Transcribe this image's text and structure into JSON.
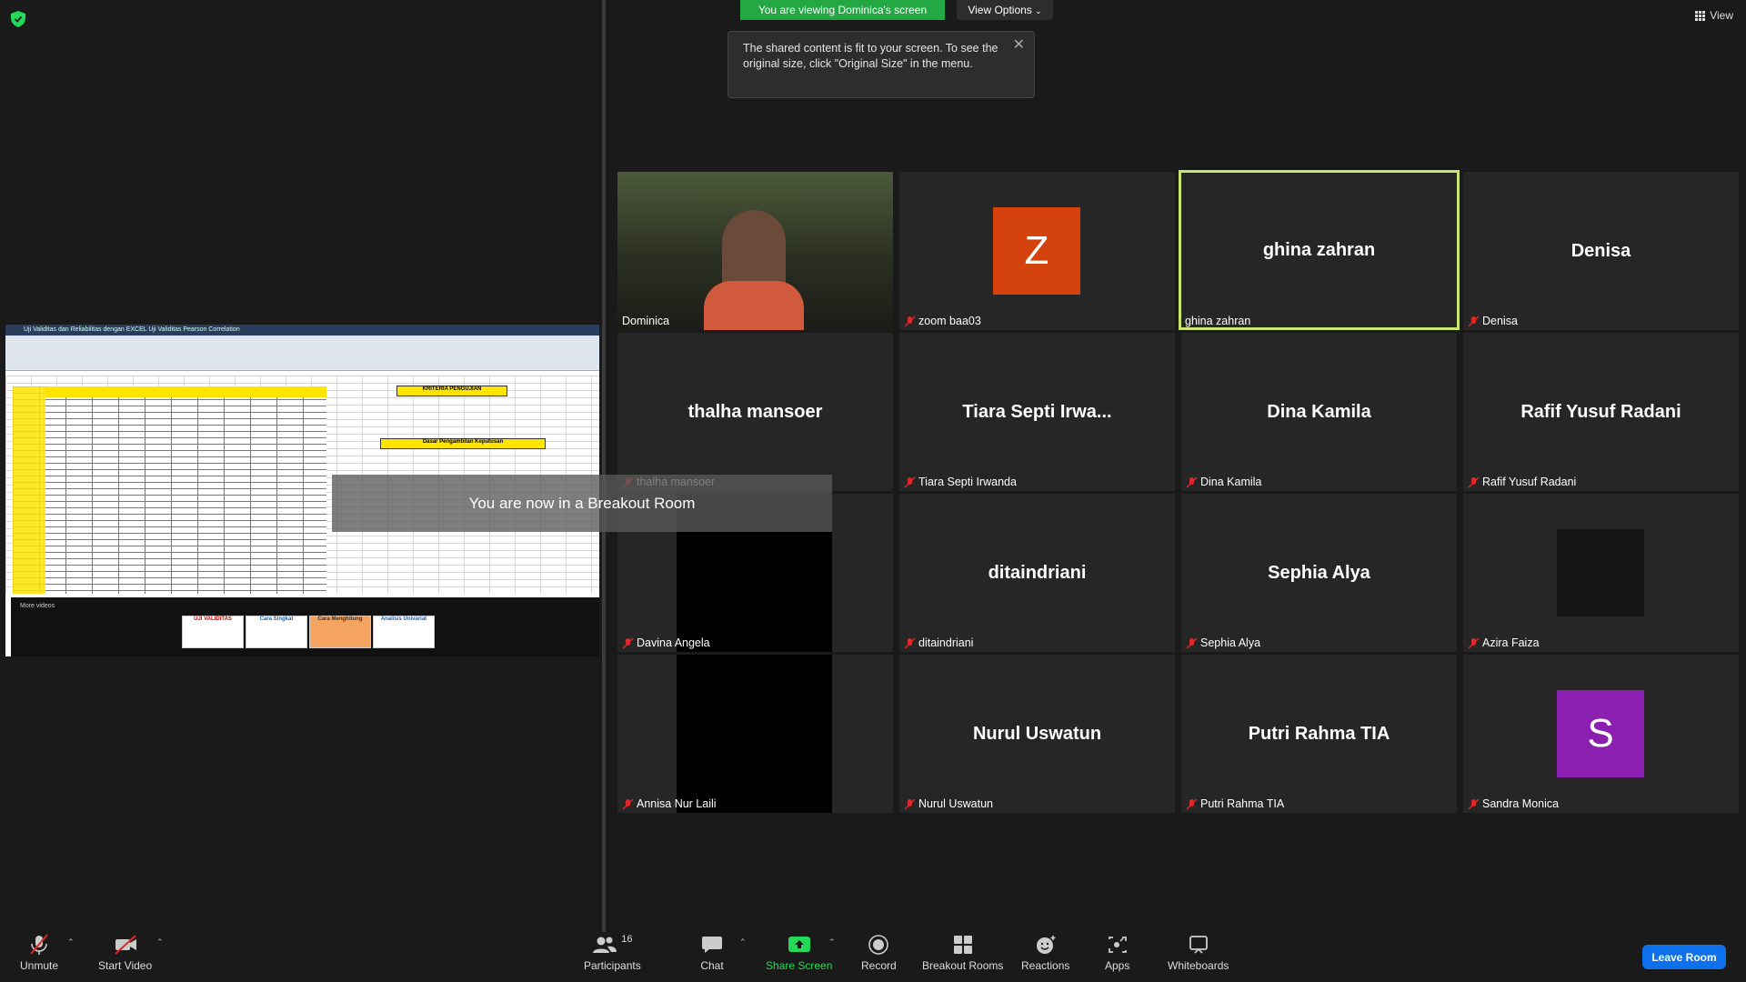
{
  "banner": {
    "viewing_text": "You are viewing Dominica's screen",
    "view_options_label": "View Options"
  },
  "tooltip": {
    "text": "The shared content is fit to your screen. To see the original size, click \"Original Size\" in the menu."
  },
  "view_button": {
    "label": "View"
  },
  "breakout_toast": {
    "text": "You are now in a Breakout Room"
  },
  "participants": [
    {
      "name": "Dominica",
      "display": "video",
      "muted": false
    },
    {
      "name": "zoom baa03",
      "display": "avatar",
      "avatar_letter": "Z",
      "avatar_color": "#d4430e",
      "muted": true
    },
    {
      "name": "ghina zahran",
      "display": "name",
      "muted": false,
      "active_speaker": true
    },
    {
      "name": "Denisa",
      "display": "name",
      "muted": true
    },
    {
      "name": "thalha mansoer",
      "display": "name",
      "muted": true
    },
    {
      "name": "Tiara Septi Irwa...",
      "label": "Tiara Septi Irwanda",
      "display": "name",
      "muted": true
    },
    {
      "name": "Dina Kamila",
      "display": "name",
      "muted": true
    },
    {
      "name": "Rafif Yusuf Radani",
      "display": "name",
      "muted": true
    },
    {
      "name": "Davina Angela",
      "display": "black",
      "muted": true
    },
    {
      "name": "ditaindriani",
      "display": "name",
      "muted": true
    },
    {
      "name": "Sephia Alya",
      "display": "name",
      "muted": true
    },
    {
      "name": "Azira Faiza",
      "display": "dark-square",
      "muted": true
    },
    {
      "name": "Annisa Nur Laili",
      "display": "black",
      "muted": true
    },
    {
      "name": "Nurul Uswatun",
      "display": "name",
      "muted": true
    },
    {
      "name": "Putri Rahma TIA",
      "display": "name",
      "muted": true
    },
    {
      "name": "Sandra Monica",
      "display": "avatar",
      "avatar_letter": "S",
      "avatar_color": "#8a1fb0",
      "muted": true
    }
  ],
  "toolbar": {
    "unmute": "Unmute",
    "start_video": "Start Video",
    "participants": "Participants",
    "participants_count": "16",
    "chat": "Chat",
    "share_screen": "Share Screen",
    "record": "Record",
    "breakout_rooms": "Breakout Rooms",
    "reactions": "Reactions",
    "apps": "Apps",
    "whiteboards": "Whiteboards",
    "leave_room": "Leave Room"
  },
  "shared_screen": {
    "title_text": "Uji Validitas dan Reliabilitas dengan EXCEL   Uji Validitas Pearson Correlation",
    "more_videos": "More videos",
    "criteria_title": "KRITERIA PENGUJIAN",
    "decision_title": "Dasar Pengambilan Keputusan",
    "thumbs": [
      "UJI VALIDITAS",
      "Cara Singkat",
      "Cara Menghitung",
      "Analisis Univariat"
    ]
  },
  "colors": {
    "active_speaker": "#cbe46b",
    "banner_green": "#23a844",
    "share_green": "#23d959",
    "leave_blue": "#0e71eb",
    "mute_red": "#e02828"
  }
}
